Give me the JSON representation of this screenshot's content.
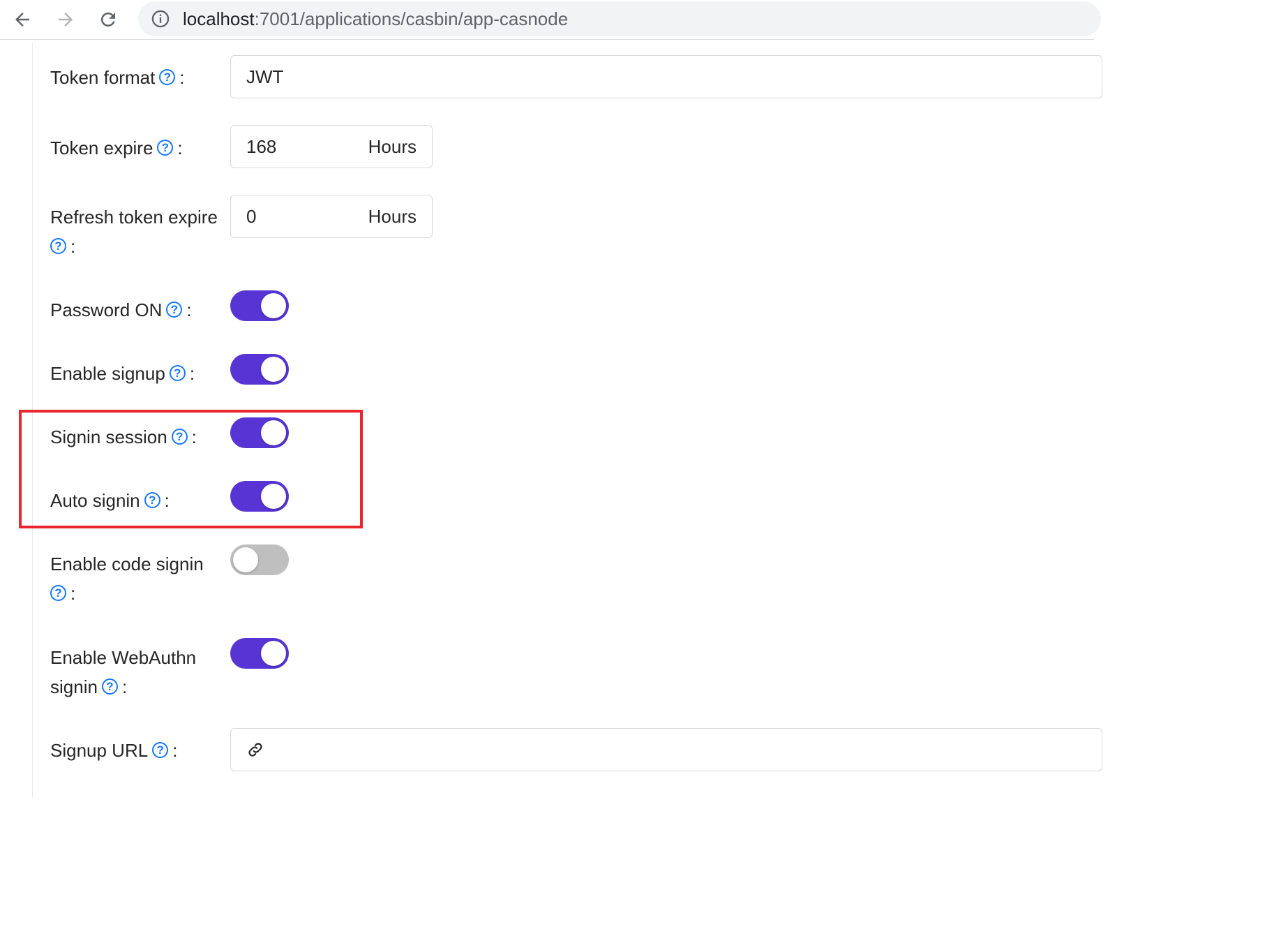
{
  "browser": {
    "url_host": "localhost",
    "url_path": ":7001/applications/casbin/app-casnode",
    "icons": [
      "back-arrow-icon",
      "forward-arrow-icon",
      "reload-icon",
      "site-info-icon"
    ]
  },
  "form": {
    "token_format": {
      "label": "Token format",
      "value": "JWT"
    },
    "token_expire": {
      "label": "Token expire",
      "value": "168",
      "suffix": "Hours"
    },
    "refresh_token_expire": {
      "label_line1": "Refresh token expire",
      "value": "0",
      "suffix": "Hours"
    },
    "password_on": {
      "label": "Password ON",
      "checked": true
    },
    "enable_signup": {
      "label": "Enable signup",
      "checked": true
    },
    "signin_session": {
      "label": "Signin session",
      "checked": true
    },
    "auto_signin": {
      "label": "Auto signin",
      "checked": true
    },
    "enable_code_signin": {
      "label_line1": "Enable code signin",
      "checked": false
    },
    "enable_webauthn_signin": {
      "label_line1": "Enable WebAuthn",
      "label_line2": "signin",
      "checked": true
    },
    "signup_url": {
      "label": "Signup URL",
      "value": ""
    },
    "colon": ":",
    "help_glyph": "?"
  },
  "colors": {
    "switch_on": "#5734d3",
    "switch_off": "#bfbfbf",
    "help_icon": "#1677ff",
    "highlight_box": "#e8262e"
  }
}
